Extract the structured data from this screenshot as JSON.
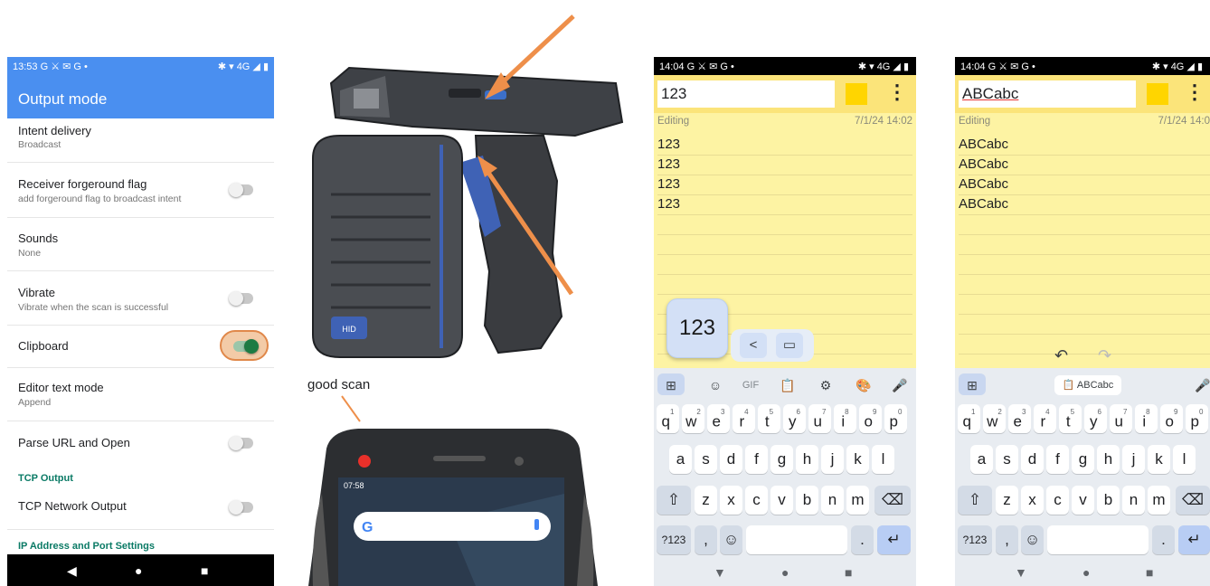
{
  "panel1": {
    "status": {
      "time": "13:53 G ⚔ ✉ G •",
      "icons": "✱ ▾ 4G ◢ ▮"
    },
    "app_title": "Output mode",
    "rows": [
      {
        "title": "Intent delivery",
        "subtitle": "Broadcast"
      },
      {
        "title": "Receiver forgeround flag",
        "subtitle": "add forgeround flag to broadcast intent"
      },
      {
        "title": "Sounds",
        "subtitle": "None"
      },
      {
        "title": "Vibrate",
        "subtitle": "Vibrate when the scan is successful"
      },
      {
        "title": "Clipboard"
      },
      {
        "title": "Editor text mode",
        "subtitle": "Append"
      },
      {
        "title": "Parse URL and Open"
      },
      {
        "title": "TCP Network Output"
      }
    ],
    "sections": {
      "tcp": "TCP Output",
      "ip": "IP Address and Port Settings"
    },
    "toggles": {
      "receiver_flag": false,
      "vibrate": false,
      "clipboard": true,
      "parse_url": false,
      "tcp_network": false
    },
    "nav": {
      "back": "◀",
      "home": "●",
      "recents": "■"
    }
  },
  "device": {
    "good_scan_label": "good scan",
    "status_time": "07:58",
    "search_logo": "G",
    "badge": "HID"
  },
  "notes1": {
    "status": {
      "time": "14:04 G ⚔ ✉ G •",
      "icons": "✱ ▾ 4G ◢ ▮"
    },
    "title": "123",
    "editing_label": "Editing",
    "date": "7/1/24 14:02",
    "lines": [
      "123",
      "123",
      "123",
      "123"
    ],
    "preview_text": "123",
    "menu": "⋮",
    "toolbar": [
      "⊞",
      "☺",
      "GIF",
      "📋",
      "⚙",
      "🎨",
      "🎤"
    ]
  },
  "notes2": {
    "status": {
      "time": "14:04 G ⚔ ✉ G •",
      "icons": "✱ ▾ 4G ◢ ▮"
    },
    "title": "ABCabc",
    "editing_label": "Editing",
    "date": "7/1/24 14:0",
    "lines": [
      "ABCabc",
      "ABCabc",
      "ABCabc",
      "ABCabc"
    ],
    "clip_chip": "ABCabc",
    "menu": "⋮"
  },
  "keyboard": {
    "row1": [
      "q",
      "w",
      "e",
      "r",
      "t",
      "y",
      "u",
      "i",
      "o",
      "p"
    ],
    "row1_hints": [
      "1",
      "2",
      "3",
      "4",
      "5",
      "6",
      "7",
      "8",
      "9",
      "0"
    ],
    "row2": [
      "a",
      "s",
      "d",
      "f",
      "g",
      "h",
      "j",
      "k",
      "l"
    ],
    "row3": [
      "z",
      "x",
      "c",
      "v",
      "b",
      "n",
      "m"
    ],
    "shift": "⇧",
    "backspace": "⌫",
    "symbols": "?123",
    "comma": ",",
    "emoji": "☺",
    "period": ".",
    "enter": "↵",
    "nav": {
      "back": "▼",
      "home": "●",
      "recents": "■"
    }
  },
  "colors": {
    "settings_accent": "#4a8ff0",
    "toggle_on": "#1e7b43",
    "highlight": "#e0884a",
    "note_bg": "#fdf3a3",
    "swatch": "#ffd500",
    "arrow": "#ee8f4a"
  }
}
